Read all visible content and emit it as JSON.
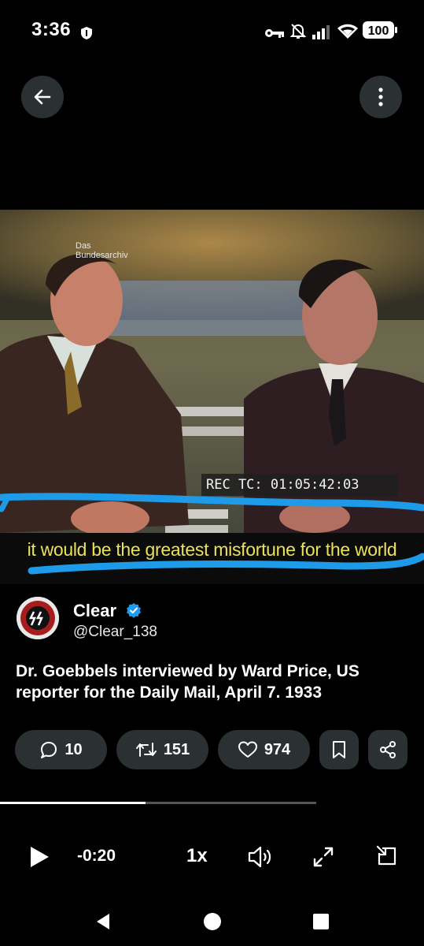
{
  "status_bar": {
    "time": "3:36",
    "battery": "100",
    "icons": [
      "shield-icon",
      "key-icon",
      "bell-off-icon",
      "signal-icon",
      "wifi-icon",
      "battery-icon"
    ]
  },
  "nav": {
    "back_icon": "arrow-left-icon",
    "more_icon": "more-vertical-icon"
  },
  "video": {
    "watermark_line1": "Das",
    "watermark_line2": "Bundesarchiv",
    "rec_label": "REC TC: 01:05:42:03",
    "subtitle": "it would be the greatest misfortune for the world",
    "annotation_color": "#1e9be8"
  },
  "tweet": {
    "author_name": "Clear",
    "author_handle": "@Clear_138",
    "text": "Dr. Goebbels interviewed by Ward Price, US reporter for the Daily Mail, April 7. 1933",
    "verified_color": "#1d9bf0"
  },
  "actions": {
    "replies": "10",
    "reposts": "151",
    "likes": "974"
  },
  "player": {
    "remaining": "-0:20",
    "speed": "1x",
    "progress": 0.46
  }
}
